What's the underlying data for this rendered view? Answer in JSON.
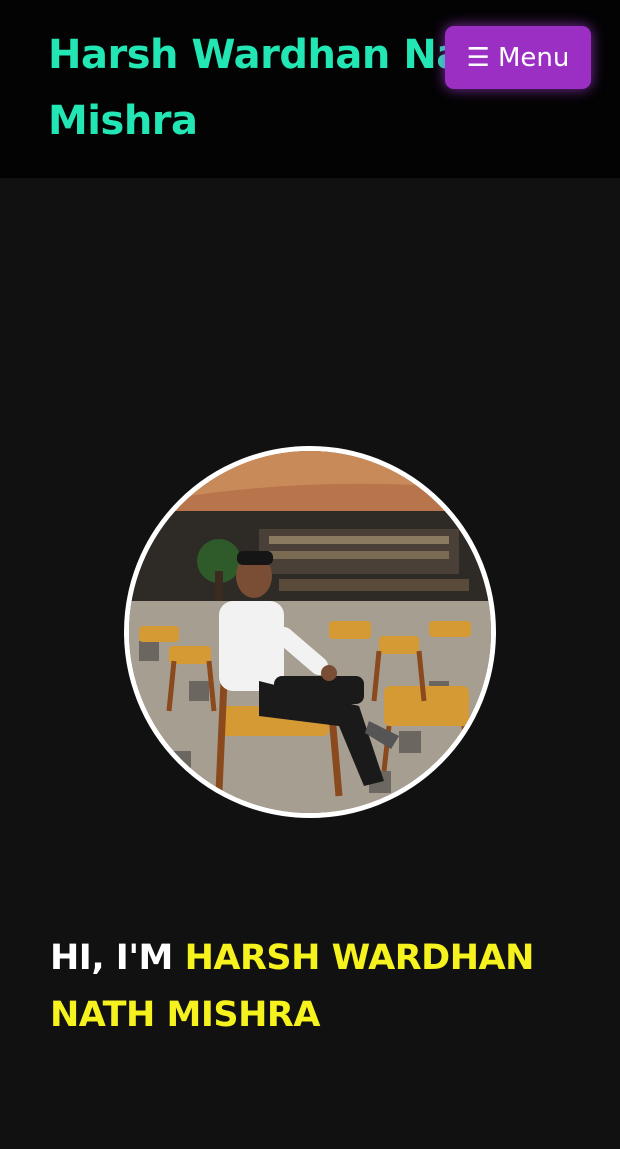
{
  "header": {
    "site_title": "Harsh Wardhan Nath Mishra",
    "menu_label": "Menu",
    "menu_icon": "☰"
  },
  "hero": {
    "greeting": "HI, I'M ",
    "name": "HARSH WARDHAN NATH MISHRA"
  },
  "colors": {
    "header_bg": "#030303",
    "page_bg": "#111111",
    "title": "#22e6b4",
    "menu_button": "#9b2fc4",
    "name_highlight": "#f6f21d"
  }
}
